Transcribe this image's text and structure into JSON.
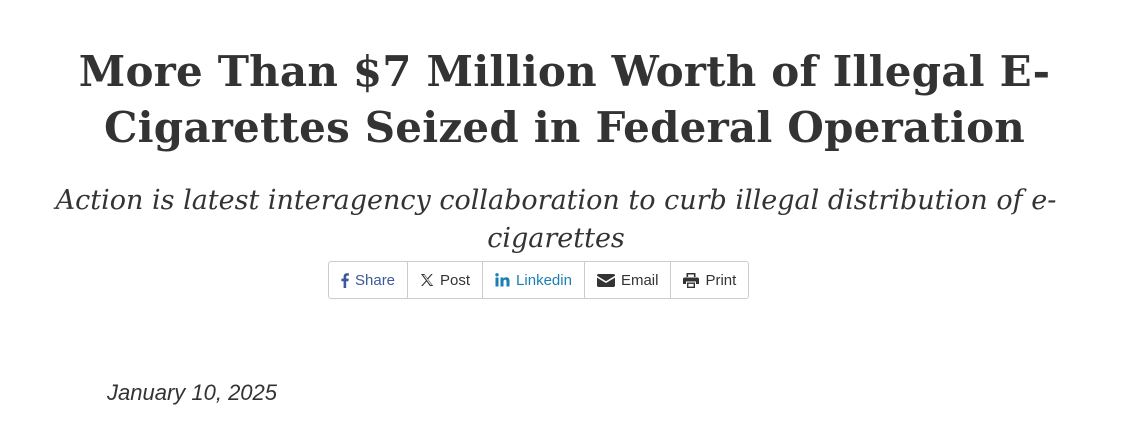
{
  "article": {
    "headline": "More Than $7 Million Worth of Illegal E-Cigarettes Seized in Federal Operation",
    "subheadline": "Action is latest interagency collaboration to curb illegal distribution of e-cigarettes",
    "date": "January 10, 2025"
  },
  "share_bar": {
    "buttons": [
      {
        "label": "Share",
        "icon": "facebook-icon"
      },
      {
        "label": "Post",
        "icon": "x-icon"
      },
      {
        "label": "Linkedin",
        "icon": "linkedin-icon"
      },
      {
        "label": "Email",
        "icon": "envelope-icon"
      },
      {
        "label": "Print",
        "icon": "printer-icon"
      }
    ]
  },
  "colors": {
    "text": "#333333",
    "facebook": "#3b5998",
    "linkedin": "#1b7fb5",
    "border": "#cccccc"
  }
}
